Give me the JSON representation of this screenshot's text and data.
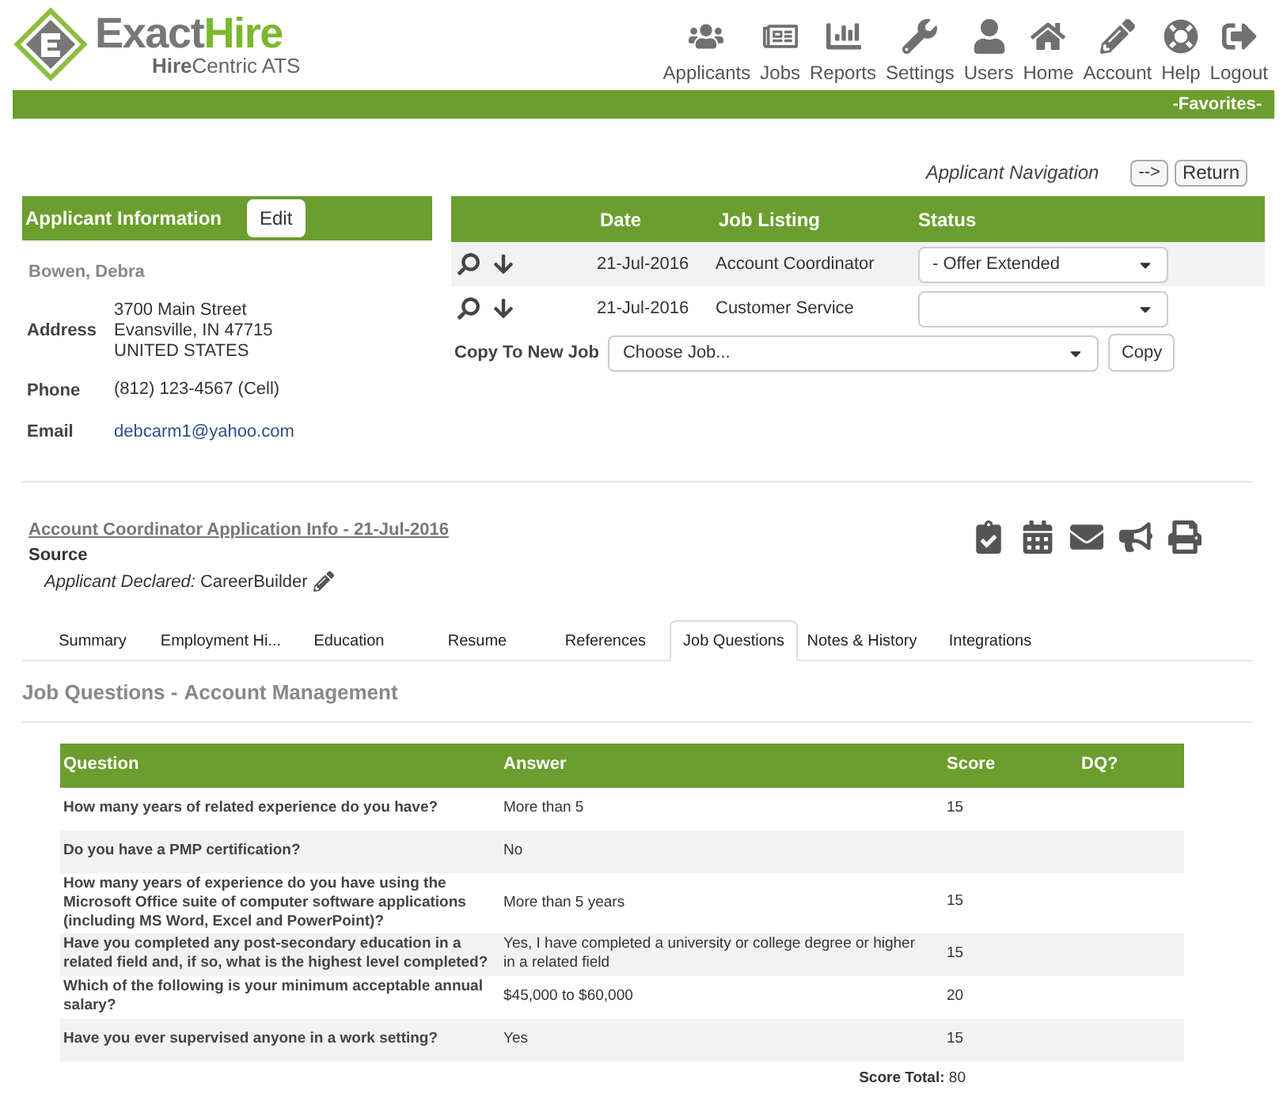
{
  "logo": {
    "word_1": "Exact",
    "word_2": "Hire",
    "subtitle": "**Hire**Centric ATS"
  },
  "nav": [
    {
      "label": "Applicants"
    },
    {
      "label": "Jobs"
    },
    {
      "label": "Reports"
    },
    {
      "label": "Settings"
    },
    {
      "label": "Users"
    },
    {
      "label": "Home"
    },
    {
      "label": "Account"
    },
    {
      "label": "Help"
    },
    {
      "label": "Logout"
    }
  ],
  "favorites": "-Favorites-",
  "applicant_navigation": {
    "label": "Applicant Navigation",
    "next": "-->",
    "return": "Return"
  },
  "applicant": {
    "title": "Applicant Information",
    "edit": "Edit",
    "name": "Bowen, Debra",
    "fields": [
      {
        "label": "Address",
        "lines": [
          "3700 Main Street",
          "Evansville, IN 47715",
          "UNITED STATES"
        ],
        "kind": "text"
      },
      {
        "label": "Phone",
        "lines": [
          "(812) 123-4567  (Cell)"
        ],
        "kind": "text"
      },
      {
        "label": "Email",
        "lines": [
          "debcarm1@yahoo.com"
        ],
        "kind": "link"
      }
    ]
  },
  "jobs": {
    "columns": [
      "Date",
      "Job Listing",
      "Status"
    ],
    "rows": [
      {
        "date": "21-Jul-2016",
        "listing": "Account Coordinator",
        "status": "- Offer Extended"
      },
      {
        "date": "21-Jul-2016",
        "listing": "Customer Service",
        "status": ""
      }
    ],
    "copy_label": "Copy To New Job",
    "copy_placeholder": "Choose Job...",
    "copy_button": "Copy"
  },
  "application": {
    "title": "Account Coordinator Application Info - 21-Jul-2016",
    "source_label": "Source",
    "source": "*Applicant Declared:* CareerBuilder"
  },
  "tabs": [
    {
      "label": "Summary",
      "selected": false
    },
    {
      "label": "Employment Hi...",
      "selected": false
    },
    {
      "label": "Education",
      "selected": false
    },
    {
      "label": "Resume",
      "selected": false
    },
    {
      "label": "References",
      "selected": false
    },
    {
      "label": "Job Questions",
      "selected": true
    },
    {
      "label": "Notes & History",
      "selected": false
    },
    {
      "label": "Integrations",
      "selected": false
    }
  ],
  "section": {
    "title": "Job Questions -",
    "subtitle": "Account Management"
  },
  "questions": {
    "columns": [
      "Question",
      "Answer",
      "Score",
      "DQ?"
    ],
    "rows": [
      {
        "question": "How many years of related experience do you have?",
        "answer": "More than 5",
        "score": "15"
      },
      {
        "question": "Do you have a PMP certification?",
        "answer": "No"
      },
      {
        "question": "How many years of experience do you have using the Microsoft Office suite of computer software applications (including MS Word, Excel and PowerPoint)?",
        "answer": "More than 5 years",
        "score": "15"
      },
      {
        "question": "Have you completed any post-secondary education in a related field and, if so, what is the highest level completed?",
        "answer": "Yes, I have completed a university or college degree or higher in a related field",
        "score": "15"
      },
      {
        "question": "Which of the following is your minimum acceptable annual salary?",
        "answer": "$45,000 to $60,000",
        "score": "20"
      },
      {
        "question": "Have you ever supervised anyone in a work setting?",
        "answer": "Yes",
        "score": "15"
      }
    ],
    "total_label": "Score Total:",
    "total": "80"
  }
}
